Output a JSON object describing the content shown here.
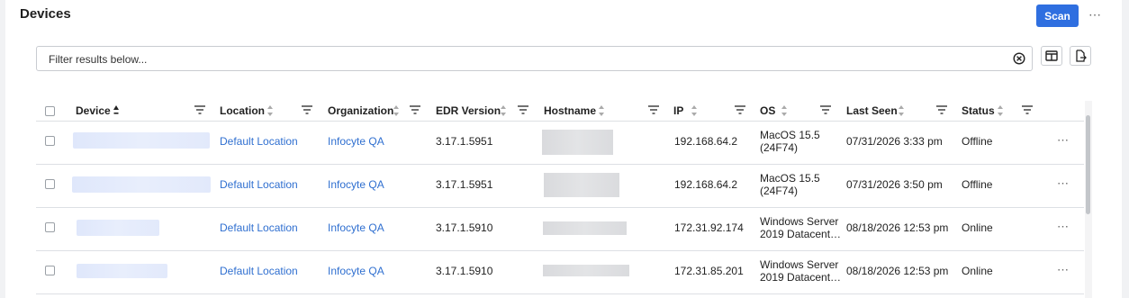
{
  "page": {
    "title": "Devices"
  },
  "actions": {
    "scan_label": "Scan"
  },
  "filter": {
    "placeholder": "Filter results below..."
  },
  "table": {
    "columns": [
      "Device",
      "Location",
      "Organization",
      "EDR Version",
      "Hostname",
      "IP",
      "OS",
      "Last Seen",
      "Status"
    ],
    "sorted_column": "Device",
    "rows": [
      {
        "location": "Default Location",
        "organization": "Infocyte QA",
        "edr_version": "3.17.1.5951",
        "ip": "192.168.64.2",
        "os_line1": "MacOS 15.5",
        "os_line2": "(24F74)",
        "last_seen": "07/31/2026 3:33 pm",
        "status": "Offline"
      },
      {
        "location": "Default Location",
        "organization": "Infocyte QA",
        "edr_version": "3.17.1.5951",
        "ip": "192.168.64.2",
        "os_line1": "MacOS 15.5",
        "os_line2": "(24F74)",
        "last_seen": "07/31/2026 3:50 pm",
        "status": "Offline"
      },
      {
        "location": "Default Location",
        "organization": "Infocyte QA",
        "edr_version": "3.17.1.5910",
        "ip": "172.31.92.174",
        "os_line1": "Windows Server",
        "os_line2": "2019 Datacent…",
        "last_seen": "08/18/2026 12:53 pm",
        "status": "Online"
      },
      {
        "location": "Default Location",
        "organization": "Infocyte QA",
        "edr_version": "3.17.1.5910",
        "ip": "172.31.85.201",
        "os_line1": "Windows Server",
        "os_line2": "2019 Datacent…",
        "last_seen": "08/18/2026 12:53 pm",
        "status": "Online"
      }
    ]
  },
  "colors": {
    "accent": "#2f6fe0",
    "link": "#2f6fd0"
  },
  "icons": [
    "more-icon",
    "clear-icon",
    "columns-icon",
    "export-icon",
    "sort-icon",
    "filter-icon",
    "checkbox-icon"
  ]
}
